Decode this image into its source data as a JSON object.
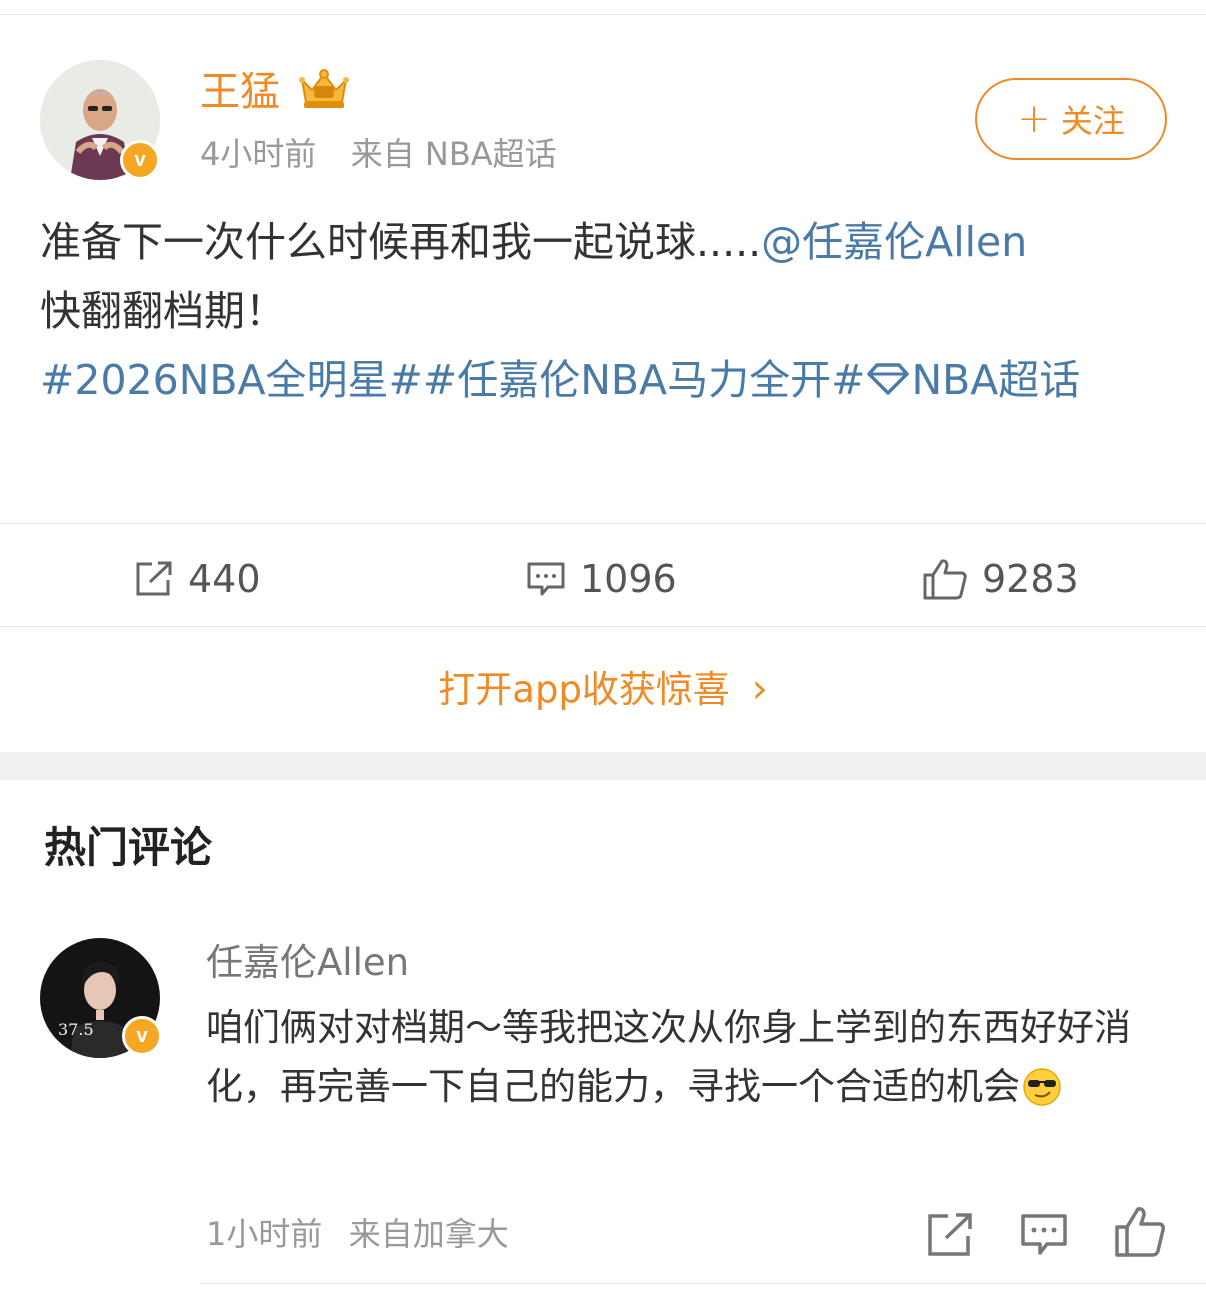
{
  "post": {
    "author_name": "王猛",
    "time": "4小时前",
    "source": "来自 NBA超话",
    "follow_plus": "+",
    "follow_label": "关注",
    "text_main": "准备下一次什么时候再和我一起说球.....",
    "mention": "@任嘉伦Allen",
    "text_line2": "快翻翻档期！",
    "tags": "#2026NBA全明星##任嘉伦NBA马力全开#",
    "tag_supertopic": "NBA超话",
    "verified_badge": "v"
  },
  "actions": {
    "repost_count": "440",
    "comment_count": "1096",
    "like_count": "9283"
  },
  "promo": {
    "label": "打开app收获惊喜",
    "arrow": "›"
  },
  "comments_section": {
    "title": "热门评论",
    "comment": {
      "author": "任嘉伦Allen",
      "text": "咱们俩对对档期～等我把这次从你身上学到的东西好好消化，再完善一下自己的能力，寻找一个合适的机会",
      "avatar_caption": "37.5",
      "time": "1小时前",
      "source": "来自加拿大",
      "verified_badge": "v",
      "emoji": "sunglasses-smirk-emoji"
    }
  },
  "colors": {
    "accent": "#f08a24",
    "link": "#4a7aa7",
    "text": "#333333",
    "muted": "#999999"
  }
}
